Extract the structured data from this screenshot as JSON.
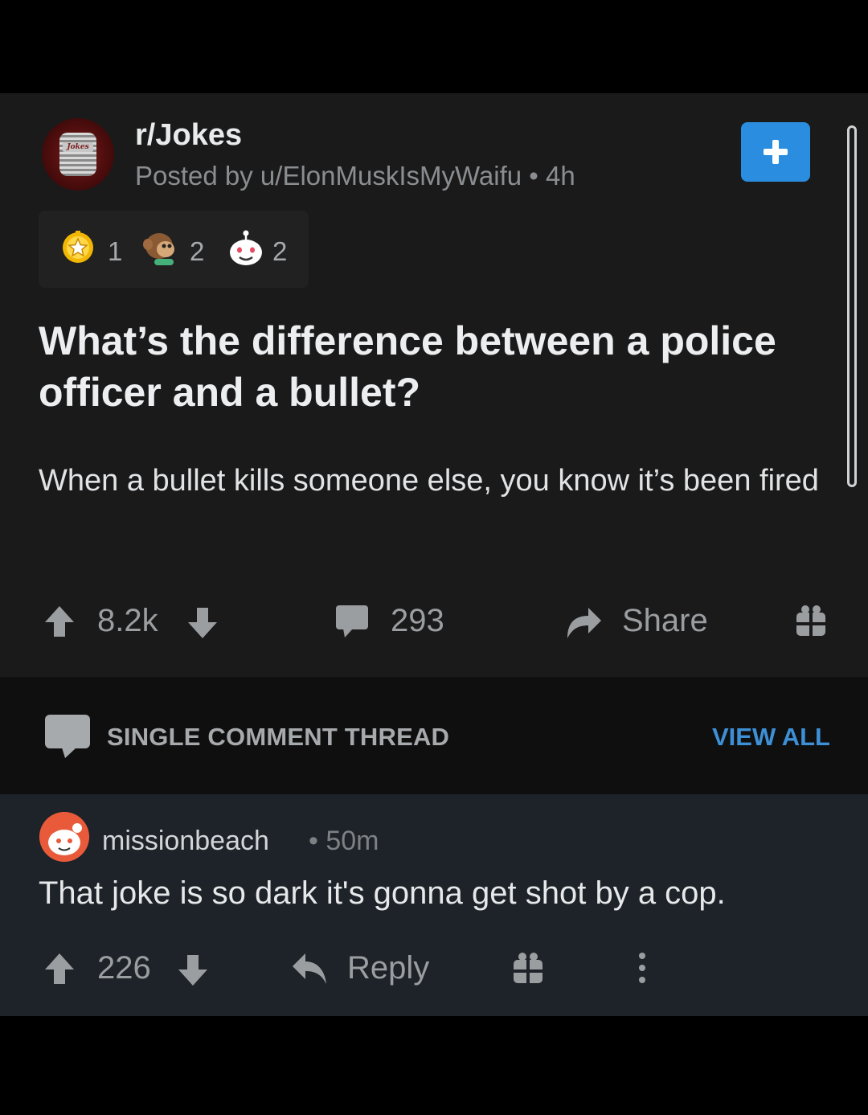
{
  "post": {
    "subreddit": "r/Jokes",
    "subreddit_avatar_label": "Jokes",
    "meta": "Posted by u/ElonMuskIsMyWaifu • 4h",
    "awards": [
      {
        "icon": "gold-award-icon",
        "count": "1"
      },
      {
        "icon": "monkey-award-icon",
        "count": "2"
      },
      {
        "icon": "wholesome-award-icon",
        "count": "2"
      }
    ],
    "title": "What’s the difference between a police officer and a bullet?",
    "body": "When a bullet kills someone else, you know it’s been fired",
    "score": "8.2k",
    "comments": "293",
    "share_label": "Share"
  },
  "thread": {
    "label": "SINGLE COMMENT THREAD",
    "view_all_label": "VIEW ALL"
  },
  "comment": {
    "author": "missionbeach",
    "time": "• 50m",
    "text": "That joke is so dark it's gonna get shot by a cop.",
    "score": "226",
    "reply_label": "Reply"
  },
  "colors": {
    "background": "#000000",
    "card": "#1a1a1b",
    "comment_card": "#1d2329",
    "accent_blue": "#2a8de0",
    "view_all": "#3d8fd6"
  }
}
